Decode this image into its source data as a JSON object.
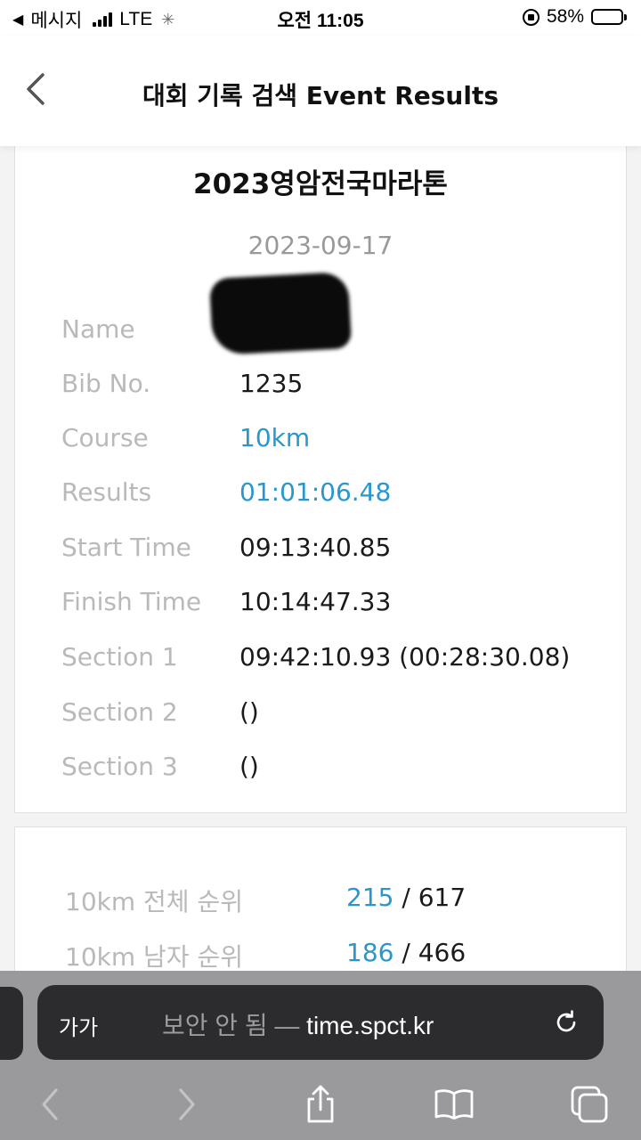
{
  "status_bar": {
    "back_app": "메시지",
    "network": "LTE",
    "time": "오전 11:05",
    "battery_text": "58%",
    "battery_level": 0.58
  },
  "header": {
    "back_icon": "chevron-left-icon",
    "title": "대회 기록 검색 Event Results"
  },
  "event": {
    "title": "2023영암전국마라톤",
    "date": "2023-09-17"
  },
  "details": [
    {
      "label": "Name",
      "value": ""
    },
    {
      "label": "Bib No.",
      "value": "1235"
    },
    {
      "label": "Course",
      "value": "10km"
    },
    {
      "label": "Results",
      "value": "01:01:06.48"
    },
    {
      "label": "Start Time",
      "value": "09:13:40.85"
    },
    {
      "label": "Finish Time",
      "value": "10:14:47.33"
    },
    {
      "label": "Section 1",
      "value": "09:42:10.93 (00:28:30.08)"
    },
    {
      "label": "Section 2",
      "value": "()"
    },
    {
      "label": "Section 3",
      "value": "()"
    }
  ],
  "rankings": [
    {
      "label": "10km 전체 순위",
      "rank": "215",
      "separator": "/",
      "total": "617"
    },
    {
      "label": "10km 남자 순위",
      "rank": "186",
      "separator": "/",
      "total": "466"
    }
  ],
  "browser": {
    "aa_label": "가가",
    "insecure_label": "보안 안 됨 —",
    "domain": "time.spct.kr",
    "icons": [
      "reload-icon",
      "back-arrow-icon",
      "forward-arrow-icon",
      "share-icon",
      "bookmarks-icon",
      "tabs-icon"
    ]
  },
  "colors": {
    "accent": "#2a97cc",
    "label_gray": "#b9b9b9",
    "browser_bg": "#9a9a9c",
    "address_bg": "#2c2c2e"
  }
}
